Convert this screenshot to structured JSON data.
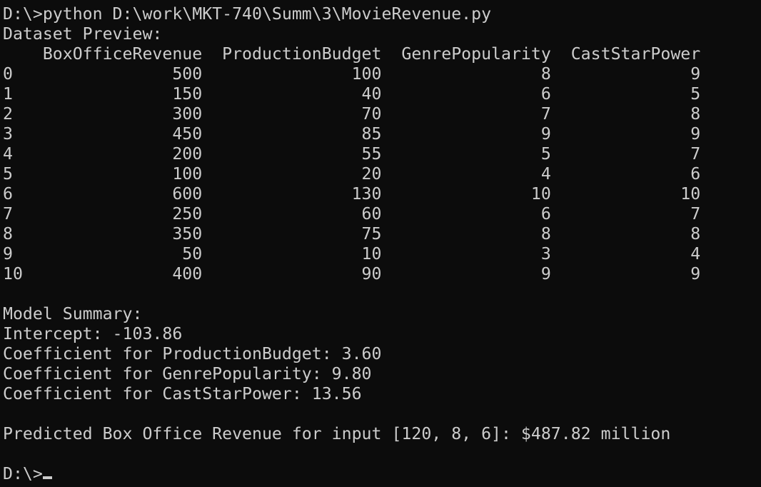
{
  "terminal": {
    "command_line": "D:\\>python D:\\work\\MKT-740\\Summ\\3\\MovieRevenue.py",
    "dataset_title": "Dataset Preview:",
    "table": {
      "header": "    BoxOfficeRevenue  ProductionBudget  GenrePopularity  CastStarPower",
      "rows": [
        "0                500               100                8              9",
        "1                150                40                6              5",
        "2                300                70                7              8",
        "3                450                85                9              9",
        "4                200                55                5              7",
        "5                100                20                4              6",
        "6                600               130               10             10",
        "7                250                60                6              7",
        "8                350                75                8              8",
        "9                 50                10                3              4",
        "10               400                90                9              9"
      ]
    },
    "summary_title": "Model Summary:",
    "intercept": "Intercept: -103.86",
    "coefficients": [
      "Coefficient for ProductionBudget: 3.60",
      "Coefficient for GenrePopularity: 9.80",
      "Coefficient for CastStarPower: 13.56"
    ],
    "prediction": "Predicted Box Office Revenue for input [120, 8, 6]: $487.82 million",
    "prompt": "D:\\>"
  }
}
